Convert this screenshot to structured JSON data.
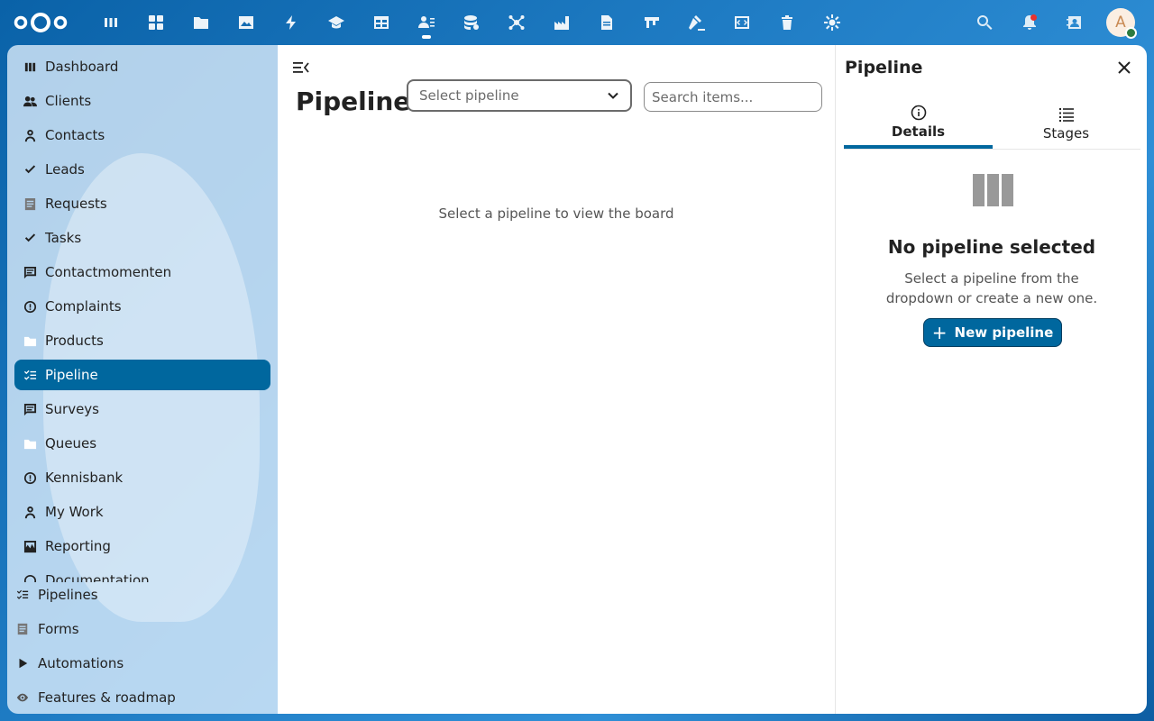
{
  "header": {
    "apps": [
      {
        "name": "dashboard-app-icon"
      },
      {
        "name": "apps-grid-icon"
      },
      {
        "name": "files-icon"
      },
      {
        "name": "photos-icon"
      },
      {
        "name": "activity-icon"
      },
      {
        "name": "learning-icon"
      },
      {
        "name": "tables-icon"
      },
      {
        "name": "contacts-icon",
        "active": true
      },
      {
        "name": "database-icon"
      },
      {
        "name": "network-icon"
      },
      {
        "name": "industry-icon"
      },
      {
        "name": "document-icon"
      },
      {
        "name": "board-icon"
      },
      {
        "name": "gavel-icon"
      },
      {
        "name": "code-icon"
      },
      {
        "name": "trash-icon"
      },
      {
        "name": "settings-app-icon"
      }
    ],
    "avatar_letter": "A"
  },
  "sidebar": {
    "items": [
      {
        "label": "Dashboard",
        "icon": "dashboard-icon"
      },
      {
        "label": "Clients",
        "icon": "clients-icon"
      },
      {
        "label": "Contacts",
        "icon": "person-icon"
      },
      {
        "label": "Leads",
        "icon": "check-icon"
      },
      {
        "label": "Requests",
        "icon": "document-icon"
      },
      {
        "label": "Tasks",
        "icon": "check-icon"
      },
      {
        "label": "Contactmomenten",
        "icon": "message-icon"
      },
      {
        "label": "Complaints",
        "icon": "alert-icon"
      },
      {
        "label": "Products",
        "icon": "folder-icon"
      },
      {
        "label": "Pipeline",
        "icon": "checklist-icon",
        "active": true
      },
      {
        "label": "Surveys",
        "icon": "message-icon"
      },
      {
        "label": "Queues",
        "icon": "folder-icon"
      },
      {
        "label": "Kennisbank",
        "icon": "info-icon"
      },
      {
        "label": "My Work",
        "icon": "person-icon"
      },
      {
        "label": "Reporting",
        "icon": "chart-icon"
      },
      {
        "label": "Documentation",
        "icon": "info-icon"
      }
    ],
    "bottom": [
      {
        "label": "Pipelines",
        "icon": "checklist-icon"
      },
      {
        "label": "Forms",
        "icon": "document-icon"
      },
      {
        "label": "Automations",
        "icon": "play-icon"
      },
      {
        "label": "Features & roadmap",
        "icon": "eye-icon"
      }
    ]
  },
  "main": {
    "title": "Pipeline",
    "select_placeholder": "Select pipeline",
    "search_placeholder": "Search items...",
    "empty_message": "Select a pipeline to view the board"
  },
  "panel": {
    "title": "Pipeline",
    "tabs": [
      {
        "label": "Details",
        "active": true
      },
      {
        "label": "Stages"
      }
    ],
    "empty_title": "No pipeline selected",
    "empty_desc": "Select a pipeline from the dropdown or create a new one.",
    "new_button": "New pipeline"
  },
  "colors": {
    "primary": "#00679e",
    "header_bg": "#0a62a8",
    "notification": "#e9322d",
    "status_online": "#2d7b41"
  }
}
